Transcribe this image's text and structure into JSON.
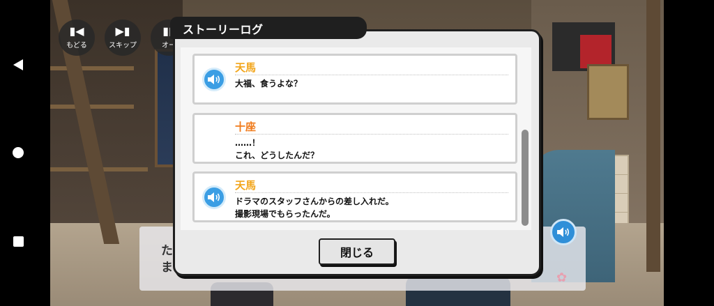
{
  "nav": {
    "back_icon": "triangle-back-icon",
    "home_icon": "circle-home-icon",
    "recents_icon": "square-recents-icon"
  },
  "controls": {
    "back_label": "もどる",
    "skip_label": "スキップ",
    "auto_label": "オー"
  },
  "textbox": {
    "line1": "た",
    "line2": "ま"
  },
  "dialog": {
    "title": "ストーリーログ",
    "close_label": "閉じる",
    "entries": [
      {
        "speaker": "天馬",
        "lines": [
          "大福、食うよな？"
        ],
        "has_voice": true
      },
      {
        "speaker": "十座",
        "lines": [
          "……！",
          "これ、どうしたんだ？"
        ],
        "has_voice": false
      },
      {
        "speaker": "天馬",
        "lines": [
          "ドラマのスタッフさんからの差し入れだ。",
          "撮影現場でもらったんだ。"
        ],
        "has_voice": true
      }
    ]
  },
  "colors": {
    "tenma": "#f2a51a",
    "juza": "#f07a1a",
    "voice_button": "#3b9ee4",
    "dialog_frame": "#1f1f1f"
  }
}
